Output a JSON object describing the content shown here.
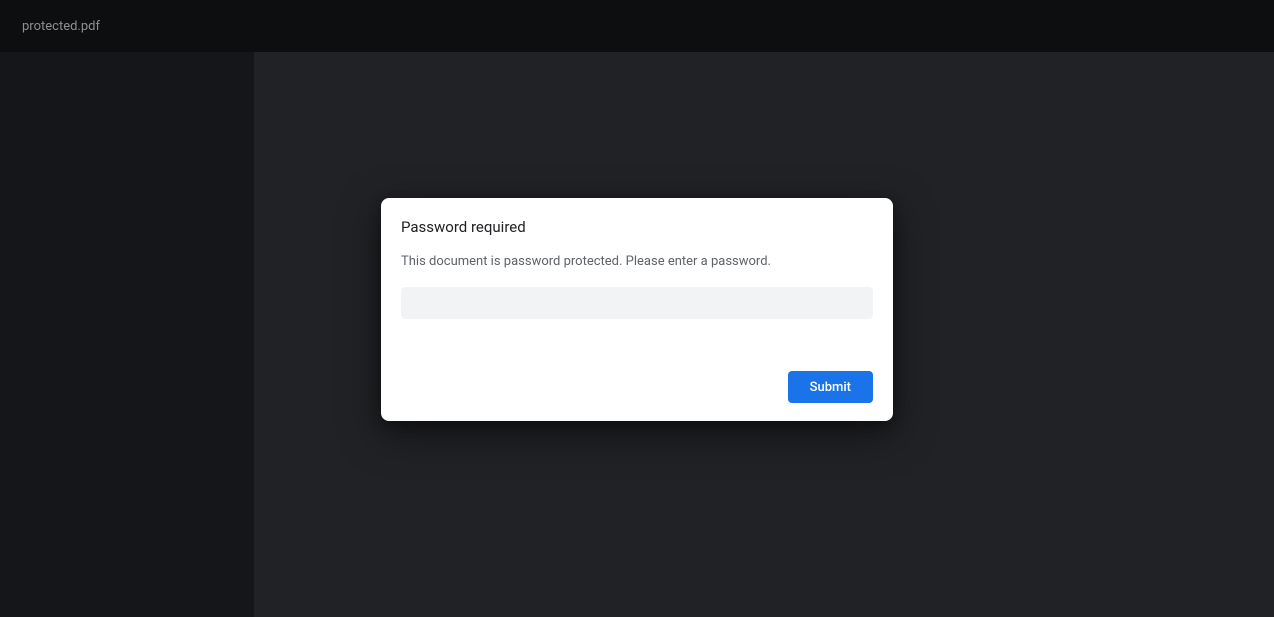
{
  "header": {
    "document_title": "protected.pdf"
  },
  "dialog": {
    "title": "Password required",
    "message": "This document is password protected. Please enter a password.",
    "password_value": "",
    "submit_label": "Submit"
  }
}
